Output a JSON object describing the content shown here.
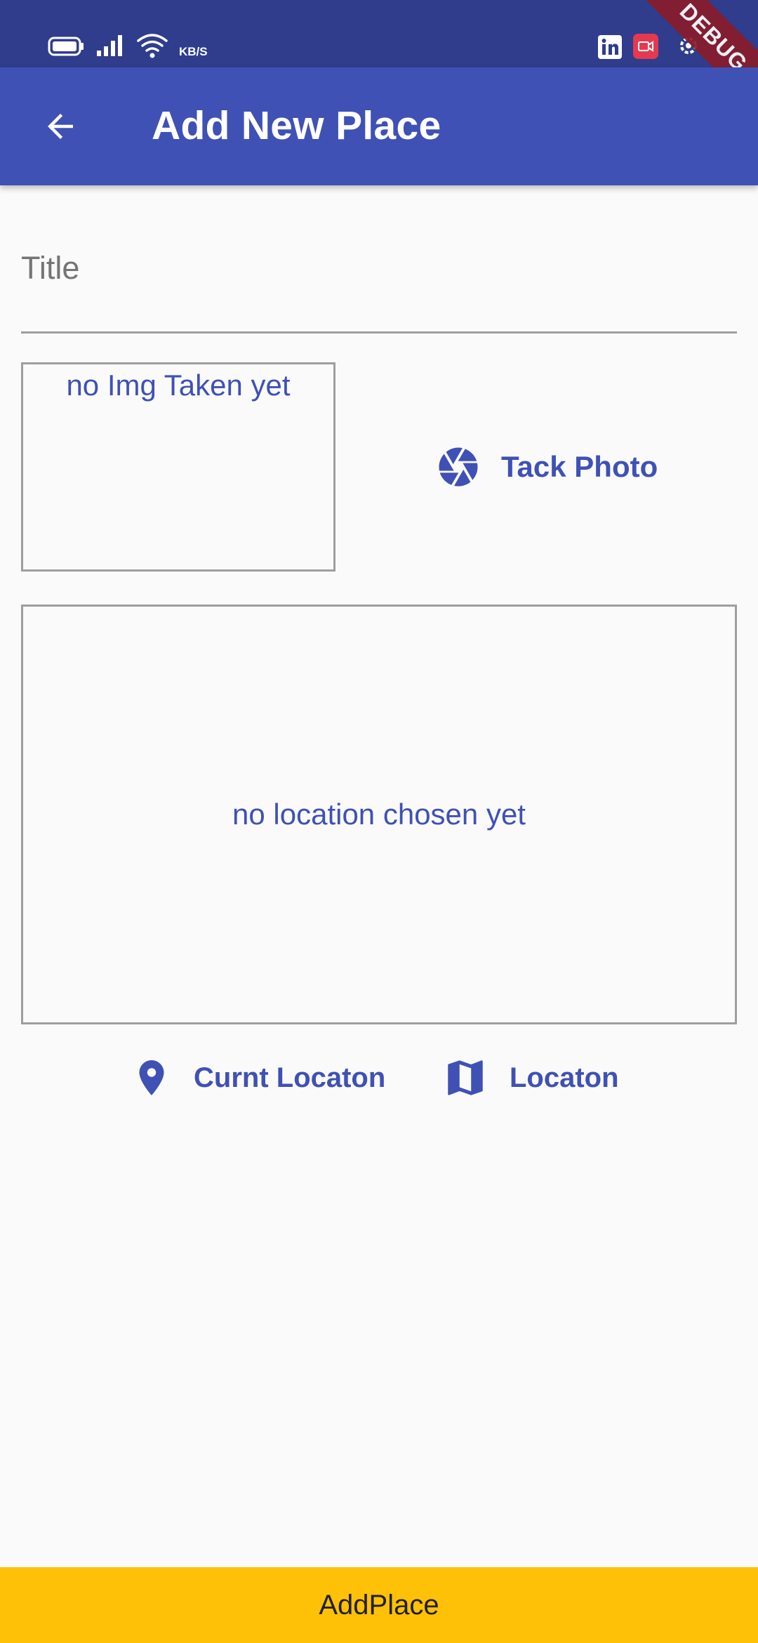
{
  "status_bar": {
    "speed_unit": "KB/S",
    "icons": [
      "battery-icon",
      "signal-icon",
      "wifi-icon",
      "linkedin-icon",
      "screen-record-icon",
      "settings-icon"
    ],
    "debug_banner": "DEBUG"
  },
  "app_bar": {
    "title": "Add New Place",
    "back_icon": "arrow-back-icon",
    "color": "#3f51b5"
  },
  "form": {
    "title_placeholder": "Title",
    "title_value": "",
    "image_preview_text": "no Img Taken yet",
    "take_photo_label": "Tack Photo",
    "location_preview_text": "no location chosen yet",
    "current_location_label": "Curnt Locaton",
    "select_on_map_label": "Locaton"
  },
  "footer": {
    "add_place_label": "AddPlace",
    "color": "#ffc107"
  }
}
